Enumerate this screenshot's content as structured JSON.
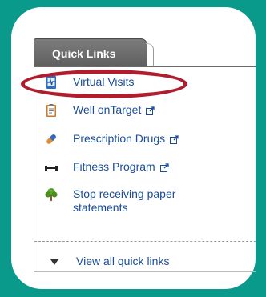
{
  "widget": {
    "tab_title": "Quick Links",
    "items": [
      {
        "label": "Virtual Visits",
        "icon": "heartbeat-monitor-icon",
        "external": false
      },
      {
        "label": "Well onTarget",
        "icon": "clipboard-icon",
        "external": true
      },
      {
        "label": "Prescription Drugs",
        "icon": "pill-capsule-icon",
        "external": true
      },
      {
        "label": "Fitness Program",
        "icon": "dumbbell-icon",
        "external": true
      },
      {
        "label": "Stop receiving paper",
        "label_line2": "statements",
        "icon": "tree-icon",
        "external": false
      }
    ],
    "view_all_label": "View all quick links"
  },
  "colors": {
    "background": "#0a9a8c",
    "link": "#1a4c9c",
    "tab": "#6b6b6b",
    "highlight_ring": "#b01d2e"
  }
}
